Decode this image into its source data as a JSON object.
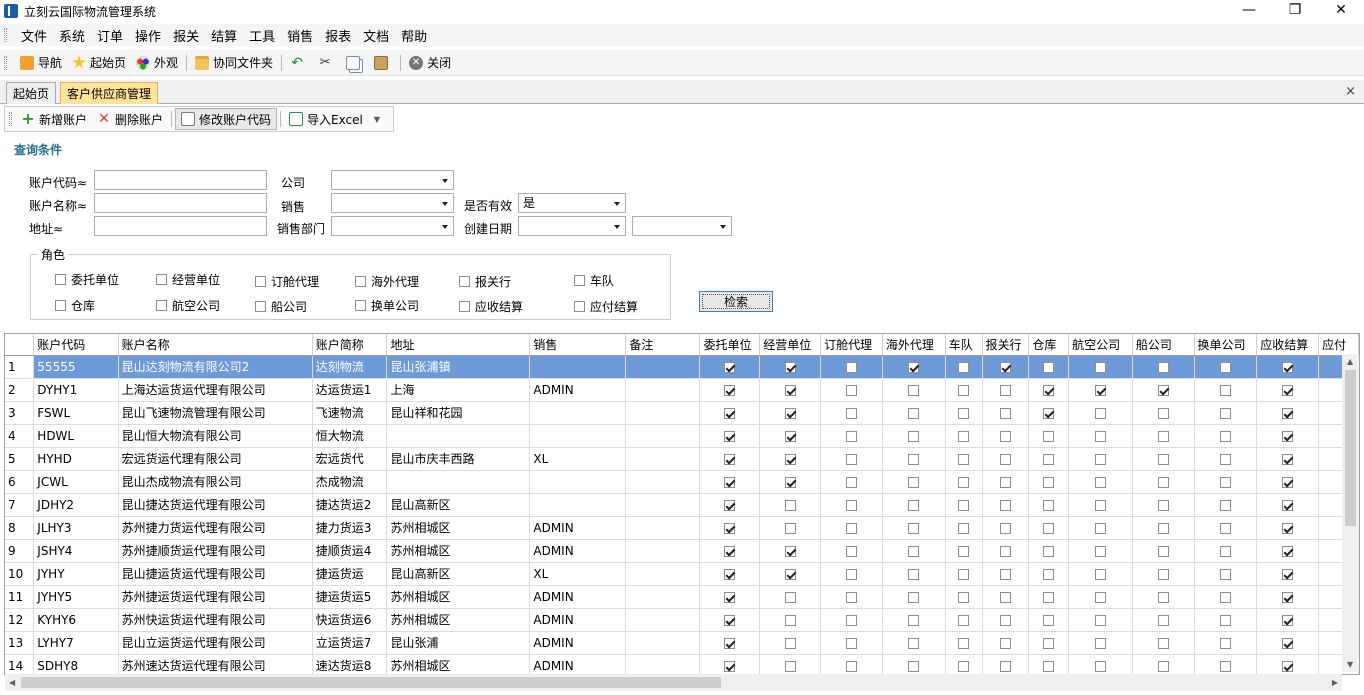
{
  "window": {
    "title": "立刻云国际物流管理系统",
    "minimize": "—",
    "restore": "❐",
    "close": "✕"
  },
  "menu": [
    "文件",
    "系统",
    "订单",
    "操作",
    "报关",
    "结算",
    "工具",
    "销售",
    "报表",
    "文档",
    "帮助"
  ],
  "toolbar": {
    "nav": "导航",
    "home": "起始页",
    "appearance": "外观",
    "shared_folder": "协同文件夹",
    "close": "关闭"
  },
  "tabs": [
    {
      "label": "起始页"
    },
    {
      "label": "客户供应商管理"
    }
  ],
  "tab_close": "×",
  "actions": {
    "add": "新增账户",
    "delete": "删除账户",
    "modify_code": "修改账户代码",
    "import": "导入Excel"
  },
  "query": {
    "title": "查询条件",
    "account_code": "账户代码≈",
    "account_name": "账户名称≈",
    "address": "地址≈",
    "company": "公司",
    "sales": "销售",
    "sales_dept": "销售部门",
    "is_valid": "是否有效",
    "is_valid_value": "是",
    "create_date": "创建日期",
    "role": "角色",
    "search": "检索"
  },
  "roles": [
    {
      "label": "委托单位"
    },
    {
      "label": "经营单位"
    },
    {
      "label": "订舱代理"
    },
    {
      "label": "海外代理"
    },
    {
      "label": "报关行"
    },
    {
      "label": "车队"
    },
    {
      "label": "仓库"
    },
    {
      "label": "航空公司"
    },
    {
      "label": "船公司"
    },
    {
      "label": "换单公司"
    },
    {
      "label": "应收结算"
    },
    {
      "label": "应付结算"
    }
  ],
  "table": {
    "columns": [
      "",
      "账户代码",
      "账户名称",
      "账户简称",
      "地址",
      "销售",
      "备注",
      "委托单位",
      "经营单位",
      "订舱代理",
      "海外代理",
      "车队",
      "报关行",
      "仓库",
      "航空公司",
      "船公司",
      "换单公司",
      "应收结算",
      "应付"
    ],
    "rows": [
      {
        "n": "1",
        "code": "55555",
        "name": "昆山达刻物流有限公司2",
        "short": "达刻物流",
        "addr": "昆山张浦镇",
        "sales": "",
        "note": "",
        "flags": [
          1,
          1,
          0,
          1,
          0,
          1,
          0,
          0,
          0,
          0,
          1
        ]
      },
      {
        "n": "2",
        "code": "DYHY1",
        "name": "上海达运货运代理有限公司",
        "short": "达运货运1",
        "addr": "上海",
        "sales": "ADMIN",
        "note": "",
        "flags": [
          1,
          1,
          0,
          0,
          0,
          0,
          1,
          1,
          1,
          0,
          1
        ]
      },
      {
        "n": "3",
        "code": "FSWL",
        "name": "昆山飞速物流管理有限公司",
        "short": "飞速物流",
        "addr": "昆山祥和花园",
        "sales": "",
        "note": "",
        "flags": [
          1,
          1,
          0,
          0,
          0,
          0,
          1,
          0,
          0,
          0,
          1
        ]
      },
      {
        "n": "4",
        "code": "HDWL",
        "name": "昆山恒大物流有限公司",
        "short": "恒大物流",
        "addr": "",
        "sales": "",
        "note": "",
        "flags": [
          1,
          1,
          0,
          0,
          0,
          0,
          0,
          0,
          0,
          0,
          1
        ]
      },
      {
        "n": "5",
        "code": "HYHD",
        "name": "宏远货运代理有限公司",
        "short": "宏远货代",
        "addr": "昆山市庆丰西路",
        "sales": "XL",
        "note": "",
        "flags": [
          1,
          1,
          0,
          0,
          0,
          0,
          0,
          0,
          0,
          0,
          1
        ]
      },
      {
        "n": "6",
        "code": "JCWL",
        "name": "昆山杰成物流有限公司",
        "short": "杰成物流",
        "addr": "",
        "sales": "",
        "note": "",
        "flags": [
          1,
          1,
          0,
          0,
          0,
          0,
          0,
          0,
          0,
          0,
          1
        ]
      },
      {
        "n": "7",
        "code": "JDHY2",
        "name": "昆山捷达货运代理有限公司",
        "short": "捷达货运2",
        "addr": "昆山高新区",
        "sales": "",
        "note": "",
        "flags": [
          1,
          0,
          0,
          0,
          0,
          0,
          0,
          0,
          0,
          0,
          1
        ]
      },
      {
        "n": "8",
        "code": "JLHY3",
        "name": "苏州捷力货运代理有限公司",
        "short": "捷力货运3",
        "addr": "苏州相城区",
        "sales": "ADMIN",
        "note": "",
        "flags": [
          1,
          0,
          0,
          0,
          0,
          0,
          0,
          0,
          0,
          0,
          1
        ]
      },
      {
        "n": "9",
        "code": "JSHY4",
        "name": "苏州捷顺货运代理有限公司",
        "short": "捷顺货运4",
        "addr": "苏州相城区",
        "sales": "ADMIN",
        "note": "",
        "flags": [
          1,
          1,
          0,
          0,
          0,
          0,
          0,
          0,
          0,
          0,
          1
        ]
      },
      {
        "n": "10",
        "code": "JYHY",
        "name": "昆山捷运货运代理有限公司",
        "short": "捷运货运",
        "addr": "昆山高新区",
        "sales": "XL",
        "note": "",
        "flags": [
          1,
          1,
          0,
          0,
          0,
          0,
          0,
          0,
          0,
          0,
          1
        ]
      },
      {
        "n": "11",
        "code": "JYHY5",
        "name": "苏州捷运货运代理有限公司",
        "short": "捷运货运5",
        "addr": "苏州相城区",
        "sales": "ADMIN",
        "note": "",
        "flags": [
          1,
          0,
          0,
          0,
          0,
          0,
          0,
          0,
          0,
          0,
          1
        ]
      },
      {
        "n": "12",
        "code": "KYHY6",
        "name": "苏州快运货运代理有限公司",
        "short": "快运货运6",
        "addr": "苏州相城区",
        "sales": "ADMIN",
        "note": "",
        "flags": [
          1,
          0,
          0,
          0,
          0,
          0,
          0,
          0,
          0,
          0,
          1
        ]
      },
      {
        "n": "13",
        "code": "LYHY7",
        "name": "昆山立运货运代理有限公司",
        "short": "立运货运7",
        "addr": "昆山张浦",
        "sales": "ADMIN",
        "note": "",
        "flags": [
          1,
          0,
          0,
          0,
          0,
          0,
          0,
          0,
          0,
          0,
          1
        ]
      },
      {
        "n": "14",
        "code": "SDHY8",
        "name": "苏州速达货运代理有限公司",
        "short": "速达货运8",
        "addr": "苏州相城区",
        "sales": "ADMIN",
        "note": "",
        "flags": [
          1,
          0,
          0,
          0,
          0,
          0,
          0,
          0,
          0,
          0,
          1
        ]
      }
    ]
  },
  "colors": {
    "selection": "#6e9bd8",
    "active_tab": "#ffe39a",
    "query_title": "#2a6e8c"
  }
}
